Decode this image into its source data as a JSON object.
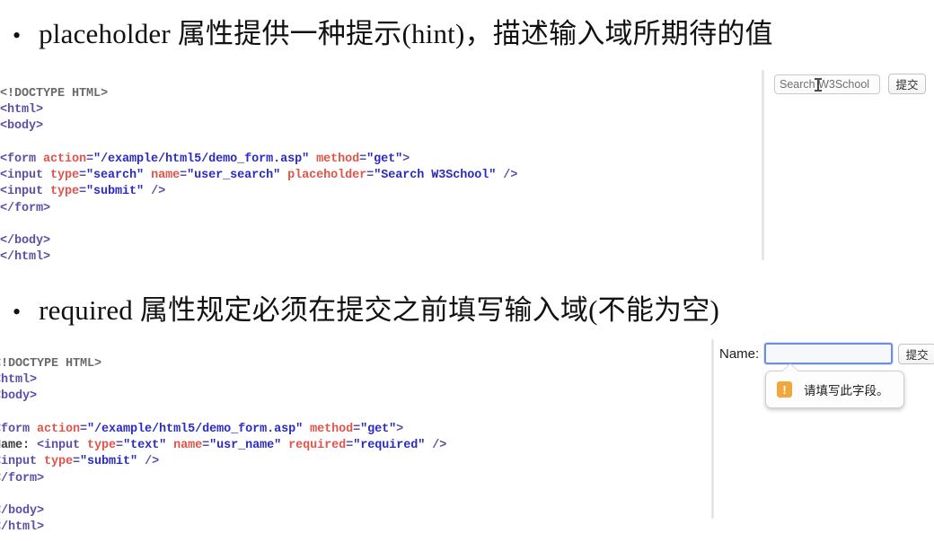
{
  "slide": {
    "bullet_marker": "•",
    "sections": [
      {
        "heading": "placeholder 属性提供一种提示(hint)，描述输入域所期待的值"
      },
      {
        "heading": "required 属性规定必须在提交之前填写输入域(不能为空)"
      }
    ]
  },
  "code_placeholder": {
    "lines": [
      [
        {
          "t": "doctype",
          "s": "<!DOCTYPE HTML>"
        }
      ],
      [
        {
          "t": "tag",
          "s": "<html>"
        }
      ],
      [
        {
          "t": "tag",
          "s": "<body>"
        }
      ],
      [
        {
          "t": "plain",
          "s": ""
        }
      ],
      [
        {
          "t": "tag",
          "s": "<form "
        },
        {
          "t": "attr",
          "s": "action"
        },
        {
          "t": "tag",
          "s": "="
        },
        {
          "t": "val",
          "s": "\"/example/html5/demo_form.asp\""
        },
        {
          "t": "tag",
          "s": " "
        },
        {
          "t": "attr",
          "s": "method"
        },
        {
          "t": "tag",
          "s": "="
        },
        {
          "t": "val",
          "s": "\"get\""
        },
        {
          "t": "tag",
          "s": ">"
        }
      ],
      [
        {
          "t": "tag",
          "s": "<input "
        },
        {
          "t": "attr",
          "s": "type"
        },
        {
          "t": "tag",
          "s": "="
        },
        {
          "t": "val",
          "s": "\"search\""
        },
        {
          "t": "tag",
          "s": " "
        },
        {
          "t": "attr",
          "s": "name"
        },
        {
          "t": "tag",
          "s": "="
        },
        {
          "t": "val",
          "s": "\"user_search\""
        },
        {
          "t": "tag",
          "s": " "
        },
        {
          "t": "attr",
          "s": "placeholder"
        },
        {
          "t": "tag",
          "s": "="
        },
        {
          "t": "val",
          "s": "\"Search W3School\""
        },
        {
          "t": "tag",
          "s": " />"
        }
      ],
      [
        {
          "t": "tag",
          "s": "<input "
        },
        {
          "t": "attr",
          "s": "type"
        },
        {
          "t": "tag",
          "s": "="
        },
        {
          "t": "val",
          "s": "\"submit\""
        },
        {
          "t": "tag",
          "s": " />"
        }
      ],
      [
        {
          "t": "tag",
          "s": "</form>"
        }
      ],
      [
        {
          "t": "plain",
          "s": ""
        }
      ],
      [
        {
          "t": "tag",
          "s": "</body>"
        }
      ],
      [
        {
          "t": "tag",
          "s": "</html>"
        }
      ]
    ]
  },
  "code_required": {
    "lines": [
      [
        {
          "t": "doctype",
          "s": "<!DOCTYPE HTML>"
        }
      ],
      [
        {
          "t": "tag",
          "s": "<html>"
        }
      ],
      [
        {
          "t": "tag",
          "s": "<body>"
        }
      ],
      [
        {
          "t": "plain",
          "s": ""
        }
      ],
      [
        {
          "t": "tag",
          "s": "<form "
        },
        {
          "t": "attr",
          "s": "action"
        },
        {
          "t": "tag",
          "s": "="
        },
        {
          "t": "val",
          "s": "\"/example/html5/demo_form.asp\""
        },
        {
          "t": "tag",
          "s": " "
        },
        {
          "t": "attr",
          "s": "method"
        },
        {
          "t": "tag",
          "s": "="
        },
        {
          "t": "val",
          "s": "\"get\""
        },
        {
          "t": "tag",
          "s": ">"
        }
      ],
      [
        {
          "t": "plain",
          "s": "Name: "
        },
        {
          "t": "tag",
          "s": "<input "
        },
        {
          "t": "attr",
          "s": "type"
        },
        {
          "t": "tag",
          "s": "="
        },
        {
          "t": "val",
          "s": "\"text\""
        },
        {
          "t": "tag",
          "s": " "
        },
        {
          "t": "attr",
          "s": "name"
        },
        {
          "t": "tag",
          "s": "="
        },
        {
          "t": "val",
          "s": "\"usr_name\""
        },
        {
          "t": "tag",
          "s": " "
        },
        {
          "t": "attr",
          "s": "required"
        },
        {
          "t": "tag",
          "s": "="
        },
        {
          "t": "val",
          "s": "\"required\""
        },
        {
          "t": "tag",
          "s": " />"
        }
      ],
      [
        {
          "t": "tag",
          "s": "<input "
        },
        {
          "t": "attr",
          "s": "type"
        },
        {
          "t": "tag",
          "s": "="
        },
        {
          "t": "val",
          "s": "\"submit\""
        },
        {
          "t": "tag",
          "s": " />"
        }
      ],
      [
        {
          "t": "tag",
          "s": "</form>"
        }
      ],
      [
        {
          "t": "plain",
          "s": ""
        }
      ],
      [
        {
          "t": "tag",
          "s": "</body>"
        }
      ],
      [
        {
          "t": "tag",
          "s": "</html>"
        }
      ]
    ]
  },
  "demo_search": {
    "input_placeholder": "Search W3School",
    "input_value": "",
    "submit_label": "提交"
  },
  "demo_required": {
    "name_label": "Name:",
    "name_value": "",
    "submit_label": "提交",
    "tooltip_message": "请填写此字段。",
    "tooltip_icon_glyph": "!",
    "tooltip_icon_color": "#f0a73c"
  },
  "colors": {
    "code_tag": "#5b4fa8",
    "code_attr": "#e0544a",
    "code_value": "#2b2bc4",
    "code_doctype": "#6b6b6b",
    "focus_border": "#6d8ee0",
    "background": "#ffffff"
  }
}
